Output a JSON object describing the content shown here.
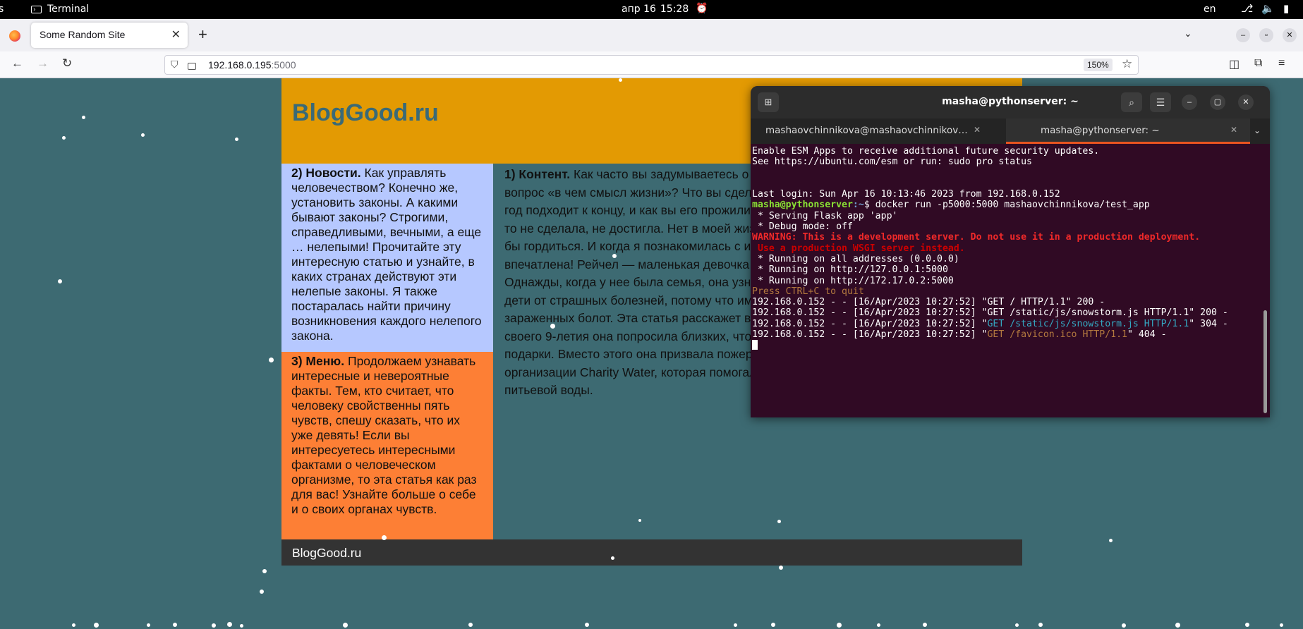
{
  "topbar": {
    "left_fragment": "s",
    "app_name": "Terminal",
    "date": "апр 16",
    "time": "15:28",
    "language": "en"
  },
  "browser": {
    "tab_title": "Some Random Site",
    "url_host": "192.168.0.195",
    "url_port": ":5000",
    "zoom": "150%"
  },
  "site": {
    "brand": "BlogGood.ru",
    "news_heading": "2) Новости.",
    "news_text": " Как управлять человечеством? Конечно же, установить законы. А какими бывают законы? Строгими, справедливыми, вечными, а еще … нелепыми! Прочитайте эту интересную статью и узнайте, в каких странах действуют эти нелепые законы. Я также постаралась найти причину возникновения каждого нелепого закона.",
    "menu_heading": "3) Меню.",
    "menu_text": " Продолжаем узнавать интересные и невероятные факты. Тем, кто считает, что человеку свойственны пять чувств, спешу сказать, что их уже девять! Если вы интересуетесь интересными фактами о человеческом организме, то эта статья как раз для вас! Узнайте больше о себе и о своих органах чувств.",
    "content_heading": "1) Контент.",
    "content_text": " Как часто вы задумываетесь о смысле жизни? Искали ли вы ответ на вопрос «в чем смысл жизни»? Что вы сделали за все эти годы жизни? Вот еще один год подходит к концу, и как вы его прожили? Я очень часто огорчаюсь от того, что чего-то не сделала, не достигла. Нет в моей жизни такого поступка, которым мне бы было бы гордиться. И когда я познакомилась с историей Рейчел, я до глубины души была впечатлена! Рейчел — маленькая девочка из Сиетла, которая родилась в 2002 году. Однажды, когда у нее была семья, она узнала, что в Африке каждый день умирают дети от страшных болезней, потому что им приходится пить воду из грязных луж и зараженных болот. Эта статья расскажет вам про ее поступок. Перед празднованием своего 9-летия она попросила близких, чтобы они не тратили деньги ей на какие-либо подарки. Вместо этого она призвала пожертвовать их для благотворительной организации Charity Water, которая помогала людям в тех странах, где не хватало питьевой воды.",
    "footer": "BlogGood.ru"
  },
  "terminal": {
    "title": "masha@pythonserver: ~",
    "tabs": [
      {
        "label": "mashaovchinnikova@mashaovchinnikov…"
      },
      {
        "label": "masha@pythonserver: ~"
      }
    ],
    "lines": {
      "l1": "Enable ESM Apps to receive additional future security updates.",
      "l2": "See https://ubuntu.com/esm or run: sudo pro status",
      "l3": "Last login: Sun Apr 16 10:13:46 2023 from 192.168.0.152",
      "prompt_user": "masha@pythonserver",
      "prompt_path": ":~",
      "prompt_cmd": "$ docker run -p5000:5000 mashaovchinnikova/test_app",
      "l5": " * Serving Flask app 'app'",
      "l6": " * Debug mode: off",
      "warn1": "WARNING: This is a development server. Do not use it in a production deployment.",
      "warn2": " Use a production WSGI server instead.",
      "l9": " * Running on all addresses (0.0.0.0)",
      "l10": " * Running on http://127.0.0.1:5000",
      "l11": " * Running on http://172.17.0.2:5000",
      "l12": "Press CTRL+C to quit",
      "log1_pre": "192.168.0.152 - - [16/Apr/2023 10:27:52] \"",
      "log1_req": "GET / HTTP/1.1",
      "log1_post": "\" 200 -",
      "log2_pre": "192.168.0.152 - - [16/Apr/2023 10:27:52] \"",
      "log2_req": "GET /static/js/snowstorm.js HTTP/1.1",
      "log2_post": "\" 200 -",
      "log3_pre": "192.168.0.152 - - [16/Apr/2023 10:27:52] \"",
      "log3_req": "GET /static/js/snowstorm.js HTTP/1.1",
      "log3_post": "\" 304 -",
      "log4_pre": "192.168.0.152 - - [16/Apr/2023 10:27:52] \"",
      "log4_req": "GET /favicon.ico HTTP/1.1",
      "log4_post": "\" 404 -"
    }
  },
  "colors": {
    "page_bg": "#3d6a72",
    "header": "#e39a03",
    "news_bg": "#b6c8ff",
    "menu_bg": "#fd7f35",
    "footer": "#333333",
    "terminal_bg": "#300a24"
  }
}
